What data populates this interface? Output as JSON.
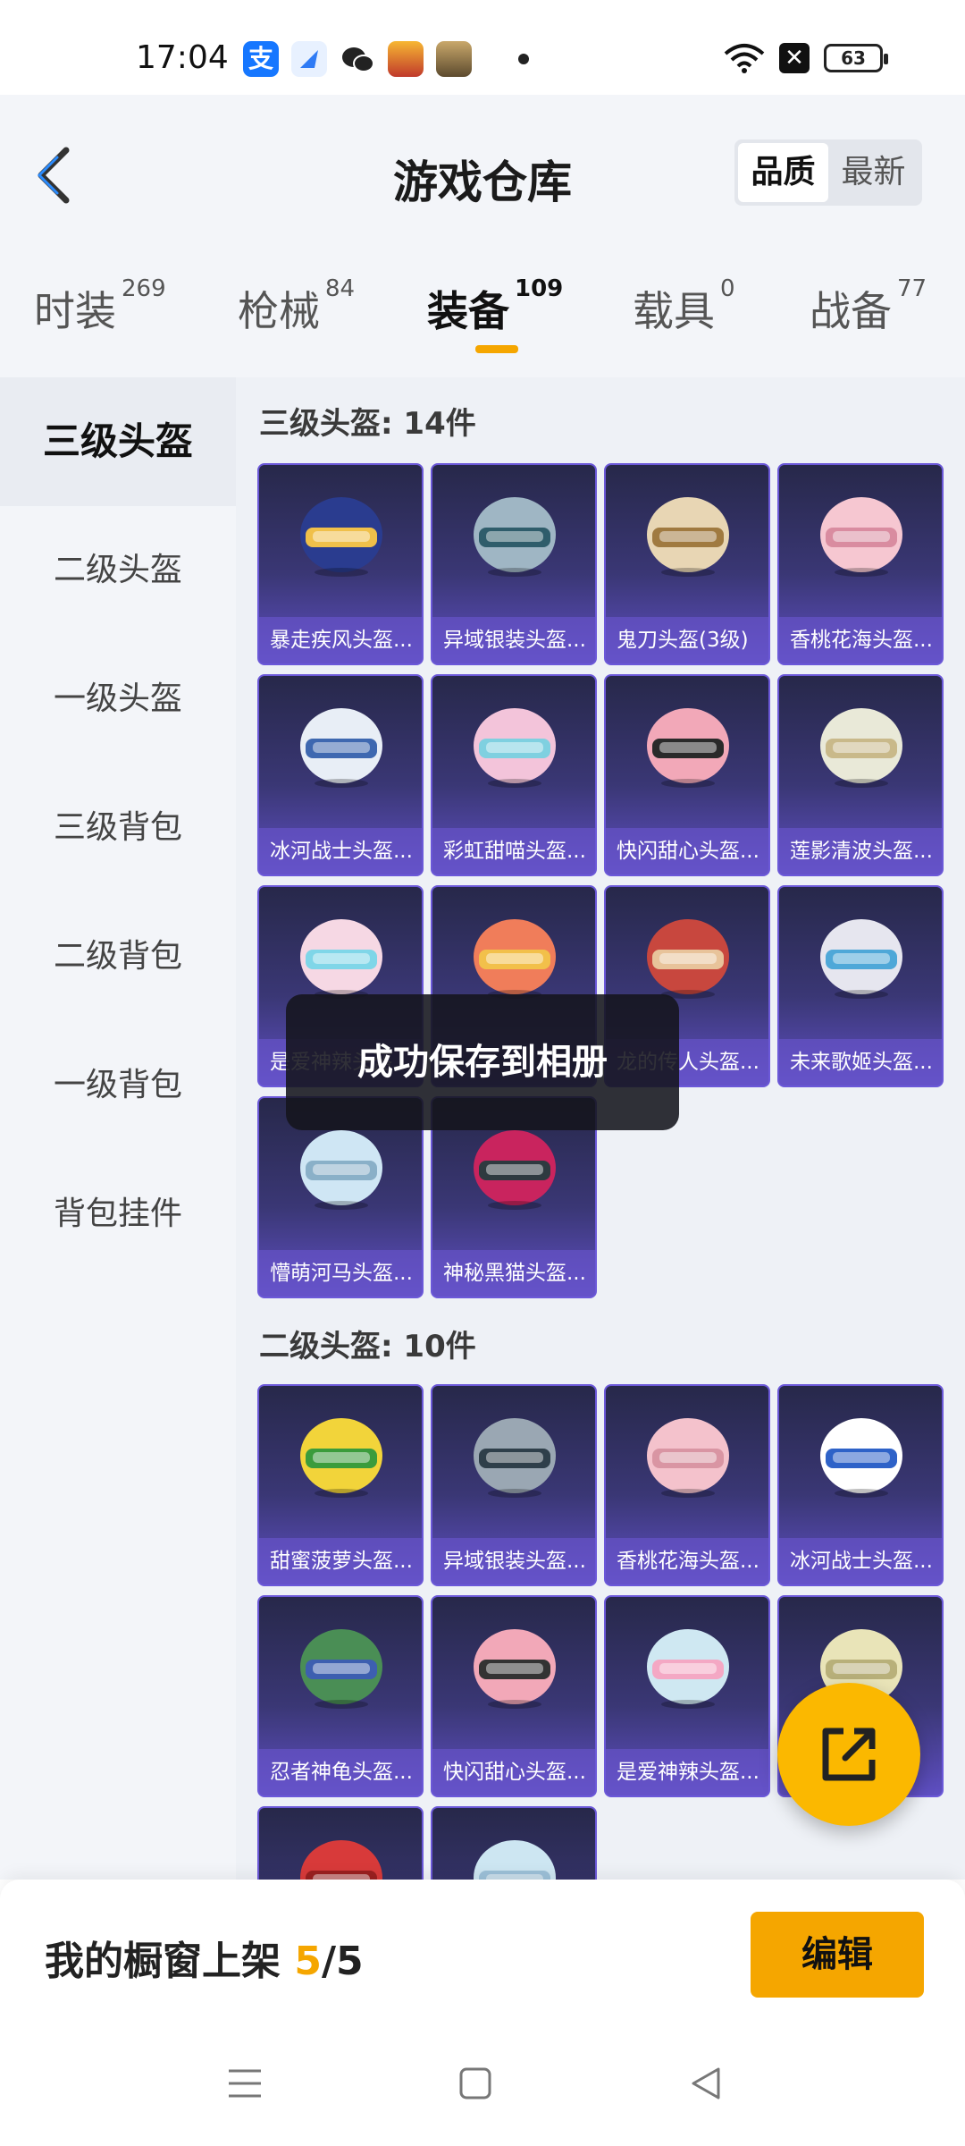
{
  "status_bar": {
    "time": "17:04",
    "battery": "63",
    "app_icons": [
      "alipay-icon",
      "lark-icon",
      "wechat-icon",
      "game-icon-1",
      "pubg-icon"
    ]
  },
  "header": {
    "title": "游戏仓库",
    "sort_options": [
      "品质",
      "最新"
    ],
    "sort_selected": "品质"
  },
  "tabs": [
    {
      "label": "时装",
      "count": "269"
    },
    {
      "label": "枪械",
      "count": "84"
    },
    {
      "label": "装备",
      "count": "109",
      "active": true
    },
    {
      "label": "载具",
      "count": "0"
    },
    {
      "label": "战备",
      "count": "77"
    }
  ],
  "sidebar": {
    "items": [
      "三级头盔",
      "二级头盔",
      "一级头盔",
      "三级背包",
      "二级背包",
      "一级背包",
      "背包挂件"
    ],
    "active_index": 0
  },
  "sections": [
    {
      "title": "三级头盔: 14件",
      "items": [
        "暴走疾风头盔...",
        "异域银装头盔...",
        "鬼刀头盔(3级)",
        "香桃花海头盔...",
        "冰河战士头盔...",
        "彩虹甜喵头盔...",
        "快闪甜心头盔...",
        "莲影清波头盔...",
        "是爱神辣头盔...",
        "",
        "龙的传人头盔...",
        "未来歌姬头盔...",
        "懵萌河马头盔...",
        "神秘黑猫头盔..."
      ]
    },
    {
      "title": "二级头盔: 10件",
      "items": [
        "甜蜜菠萝头盔...",
        "异域银装头盔...",
        "香桃花海头盔...",
        "冰河战士头盔...",
        "忍者神龟头盔...",
        "快闪甜心头盔...",
        "是爱神辣头盔...",
        "",
        "",
        ""
      ]
    }
  ],
  "toast": "成功保存到相册",
  "bottom_bar": {
    "label": "我的橱窗上架",
    "count": "5",
    "total": "/5",
    "edit_label": "编辑"
  },
  "colors": {
    "accent": "#f5a600",
    "card_top": "#27284a",
    "card_bottom": "#5f4fc3"
  }
}
